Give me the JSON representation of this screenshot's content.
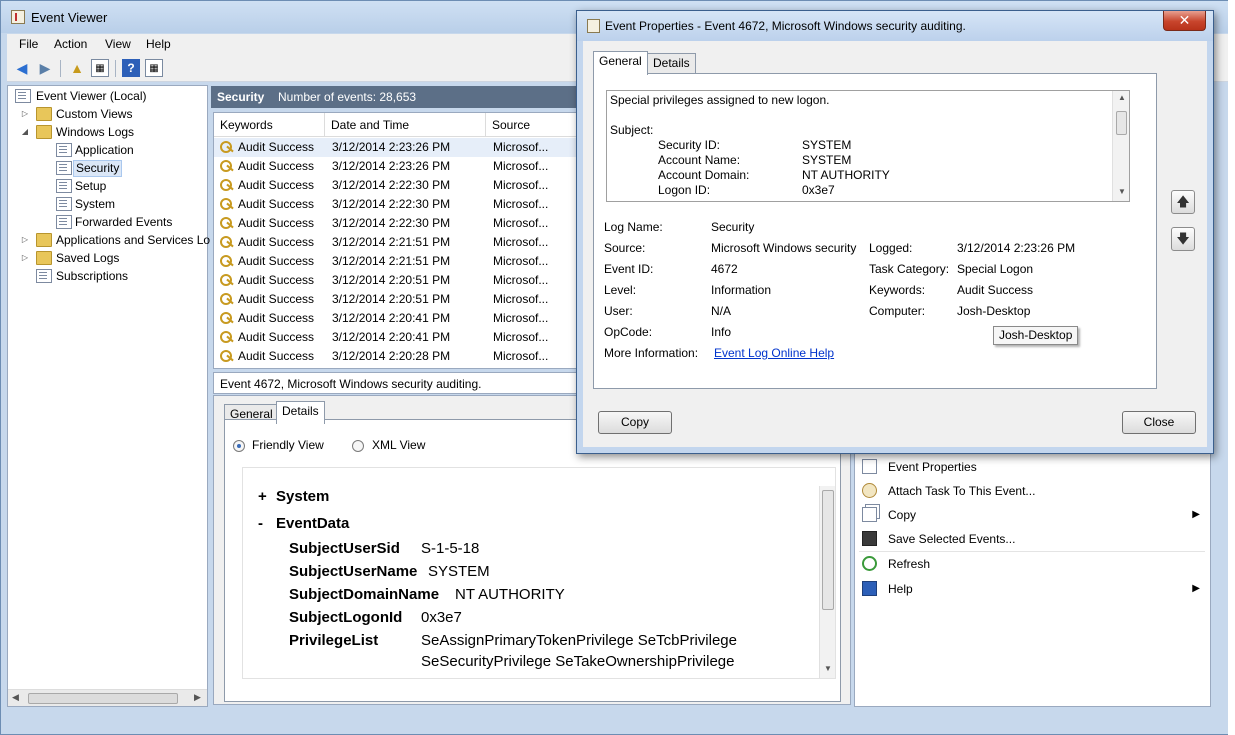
{
  "main_window": {
    "title": "Event Viewer",
    "menu": [
      "File",
      "Action",
      "View",
      "Help"
    ]
  },
  "tree": {
    "items": [
      {
        "label": "Event Viewer (Local)"
      },
      {
        "label": "Custom Views"
      },
      {
        "label": "Windows Logs"
      },
      {
        "label": "Application"
      },
      {
        "label": "Security"
      },
      {
        "label": "Setup"
      },
      {
        "label": "System"
      },
      {
        "label": "Forwarded Events"
      },
      {
        "label": "Applications and Services Lo"
      },
      {
        "label": "Saved Logs"
      },
      {
        "label": "Subscriptions"
      }
    ]
  },
  "log_header": {
    "title": "Security",
    "count": "Number of events: 28,653"
  },
  "events_table": {
    "columns": [
      "Keywords",
      "Date and Time",
      "Source"
    ],
    "rows": [
      {
        "keywords": "Audit Success",
        "datetime": "3/12/2014 2:23:26 PM",
        "source": "Microsof..."
      },
      {
        "keywords": "Audit Success",
        "datetime": "3/12/2014 2:23:26 PM",
        "source": "Microsof..."
      },
      {
        "keywords": "Audit Success",
        "datetime": "3/12/2014 2:22:30 PM",
        "source": "Microsof..."
      },
      {
        "keywords": "Audit Success",
        "datetime": "3/12/2014 2:22:30 PM",
        "source": "Microsof..."
      },
      {
        "keywords": "Audit Success",
        "datetime": "3/12/2014 2:22:30 PM",
        "source": "Microsof..."
      },
      {
        "keywords": "Audit Success",
        "datetime": "3/12/2014 2:21:51 PM",
        "source": "Microsof..."
      },
      {
        "keywords": "Audit Success",
        "datetime": "3/12/2014 2:21:51 PM",
        "source": "Microsof..."
      },
      {
        "keywords": "Audit Success",
        "datetime": "3/12/2014 2:20:51 PM",
        "source": "Microsof..."
      },
      {
        "keywords": "Audit Success",
        "datetime": "3/12/2014 2:20:51 PM",
        "source": "Microsof..."
      },
      {
        "keywords": "Audit Success",
        "datetime": "3/12/2014 2:20:41 PM",
        "source": "Microsof..."
      },
      {
        "keywords": "Audit Success",
        "datetime": "3/12/2014 2:20:41 PM",
        "source": "Microsof..."
      },
      {
        "keywords": "Audit Success",
        "datetime": "3/12/2014 2:20:28 PM",
        "source": "Microsof..."
      }
    ]
  },
  "preview": {
    "header": "Event 4672, Microsoft Windows security auditing.",
    "tabs": [
      "General",
      "Details"
    ],
    "radio_friendly": "Friendly View",
    "radio_xml": "XML View",
    "system_toggle": "+",
    "system_label": "System",
    "eventdata_toggle": "-",
    "eventdata_label": "EventData",
    "fields": [
      {
        "key": "SubjectUserSid",
        "value": "S-1-5-18"
      },
      {
        "key": "SubjectUserName",
        "value": "SYSTEM"
      },
      {
        "key": "SubjectDomainName",
        "value": "NT AUTHORITY"
      },
      {
        "key": "SubjectLogonId",
        "value": "0x3e7"
      },
      {
        "key": "PrivilegeList",
        "value": "SeAssignPrimaryTokenPrivilege SeTcbPrivilege"
      }
    ],
    "privilege_line2": "SeSecurityPrivilege SeTakeOwnershipPrivilege"
  },
  "actions": {
    "items": [
      {
        "label": "Event Properties",
        "icon": "properties-icon"
      },
      {
        "label": "Attach Task To This Event...",
        "icon": "task-icon"
      },
      {
        "label": "Copy",
        "icon": "copy-icon",
        "submenu": true
      },
      {
        "label": "Save Selected Events...",
        "icon": "save-icon"
      },
      {
        "label": "Refresh",
        "icon": "refresh-icon"
      },
      {
        "label": "Help",
        "icon": "help-icon",
        "submenu": true
      }
    ]
  },
  "dialog": {
    "title": "Event Properties - Event 4672, Microsoft Windows security auditing.",
    "tabs": [
      "General",
      "Details"
    ],
    "description": {
      "line1": "Special privileges assigned to new logon.",
      "subject": "Subject:",
      "fields": [
        {
          "key": "Security ID:",
          "value": "SYSTEM"
        },
        {
          "key": "Account Name:",
          "value": "SYSTEM"
        },
        {
          "key": "Account Domain:",
          "value": "NT AUTHORITY"
        },
        {
          "key": "Logon ID:",
          "value": "0x3e7"
        }
      ]
    },
    "props": {
      "log_name_label": "Log Name:",
      "log_name": "Security",
      "source_label": "Source:",
      "source": "Microsoft Windows security",
      "logged_label": "Logged:",
      "logged": "3/12/2014 2:23:26 PM",
      "event_id_label": "Event ID:",
      "event_id": "4672",
      "task_category_label": "Task Category:",
      "task_category": "Special Logon",
      "level_label": "Level:",
      "level": "Information",
      "keywords_label": "Keywords:",
      "keywords": "Audit Success",
      "user_label": "User:",
      "user": "N/A",
      "computer_label": "Computer:",
      "computer": "Josh-Desktop",
      "opcode_label": "OpCode:",
      "opcode": "Info",
      "more_info_label": "More Information:",
      "more_info_link": "Event Log Online Help"
    },
    "tooltip": "Josh-Desktop",
    "copy_button": "Copy",
    "close_button": "Close"
  }
}
